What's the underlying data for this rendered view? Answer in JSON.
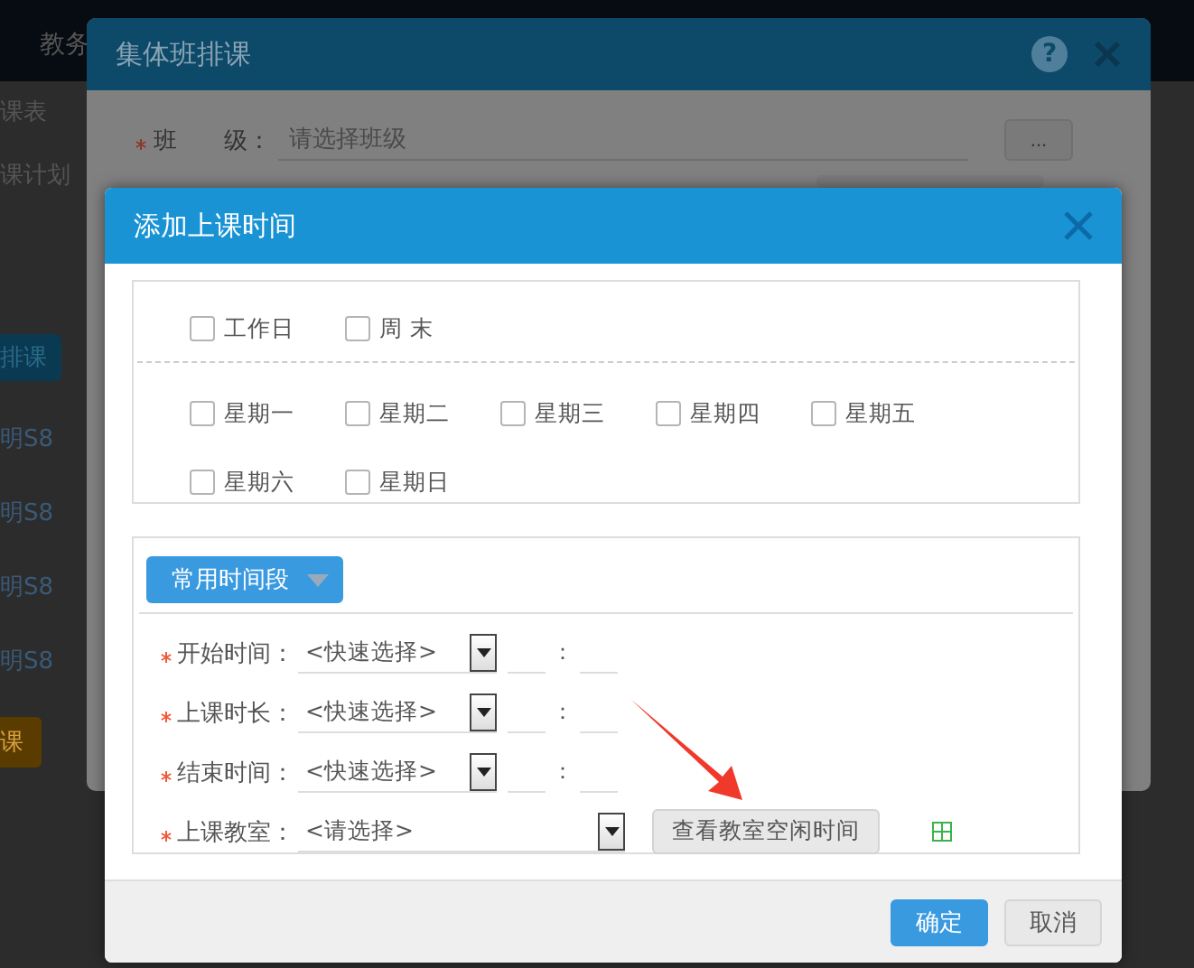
{
  "background": {
    "nav_tab": "教务",
    "sidebar_items": [
      "课表",
      "课计划"
    ],
    "action_button": "排课",
    "rows": [
      "明S8",
      "明S8",
      "明S8",
      "明S8"
    ],
    "bottom_button": "课"
  },
  "outer_dialog": {
    "title": "集体班排课",
    "help_icon": "?",
    "class_field": {
      "label": "班　　级：",
      "required": true,
      "placeholder": "请选择班级"
    },
    "browse_button": "..."
  },
  "dialog": {
    "title": "添加上课时间",
    "groups": [
      {
        "options": [
          {
            "label": "工作日",
            "checked": false
          },
          {
            "label": "周 末",
            "checked": false
          }
        ]
      },
      {
        "options": [
          {
            "label": "星期一",
            "checked": false
          },
          {
            "label": "星期二",
            "checked": false
          },
          {
            "label": "星期三",
            "checked": false
          },
          {
            "label": "星期四",
            "checked": false
          },
          {
            "label": "星期五",
            "checked": false
          },
          {
            "label": "星期六",
            "checked": false
          },
          {
            "label": "星期日",
            "checked": false
          }
        ]
      }
    ],
    "preset_button": "常用时间段",
    "fields": [
      {
        "kind": "time",
        "label": "开始时间：",
        "required": true,
        "select": "<快速选择>",
        "separator": "："
      },
      {
        "kind": "time",
        "label": "上课时长：",
        "required": true,
        "select": "<快速选择>",
        "separator": "："
      },
      {
        "kind": "time",
        "label": "结束时间：",
        "required": true,
        "select": "<快速选择>",
        "separator": "："
      },
      {
        "kind": "room",
        "label": "上课教室：",
        "required": true,
        "select": "<请选择>",
        "action": "查看教室空闲时间"
      }
    ],
    "buttons": [
      {
        "label": "确定",
        "primary": true
      },
      {
        "label": "取消",
        "primary": false
      }
    ]
  }
}
